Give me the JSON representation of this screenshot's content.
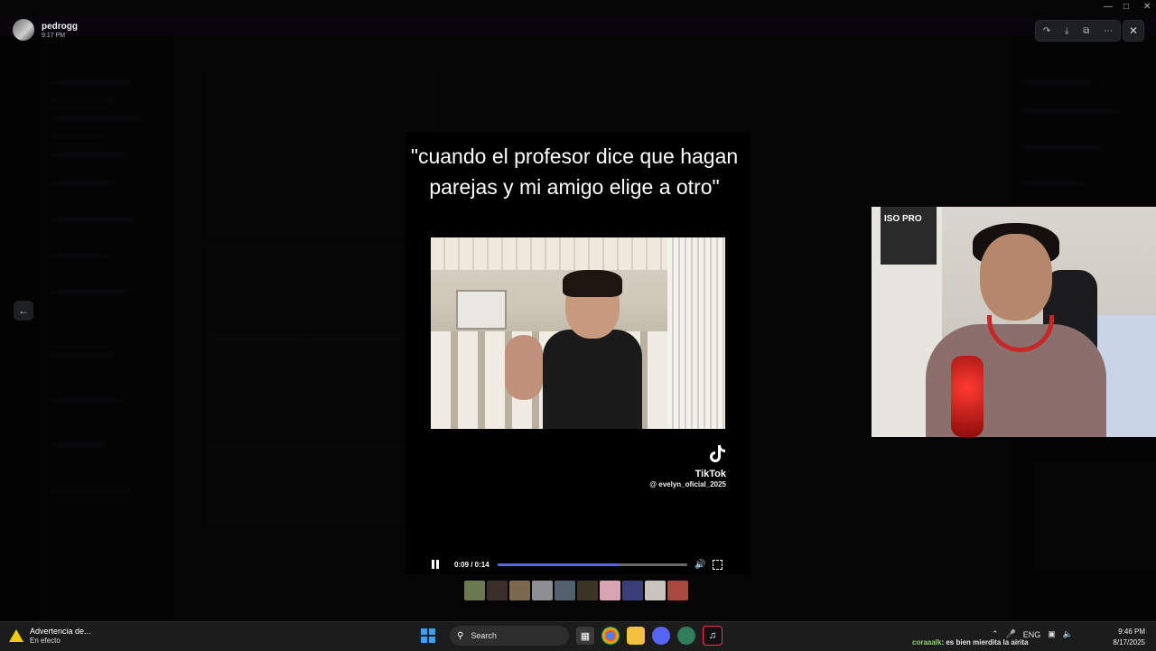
{
  "viewer": {
    "author_name": "pedrogg",
    "author_time": "9:17 PM",
    "toolbar_icons": [
      "forward-icon",
      "download-icon",
      "open-external-icon",
      "more-icon"
    ],
    "close_icon": "close-icon",
    "prev_icon": "arrow-left-icon"
  },
  "video": {
    "caption": "\"cuando el profesor dice que hagan parejas y mi amigo elige a otro\"",
    "watermark_brand": "TikTok",
    "watermark_handle": "@ evelyn_oficial_2025",
    "time_display": "0:09 / 0:14",
    "progress_fraction": 0.64,
    "playing": true
  },
  "thumbnails": {
    "count": 10,
    "colors": [
      "#6b7a4c",
      "#3a2f2a",
      "#7c6a4e",
      "#8d8f92",
      "#52606d",
      "#3c3424",
      "#d7a4b1",
      "#3a3f7a",
      "#c9c4bc",
      "#a8493f"
    ]
  },
  "webcam": {
    "box_label": "ISO PRO"
  },
  "taskbar": {
    "notification_title": "Advertencia de...",
    "notification_subtitle": "En efecto",
    "search_label": "Search",
    "chat_user": "coraaalk",
    "chat_message": ": es bien mierdita la airita",
    "language": "ENG",
    "time": "9:46 PM",
    "date": "8/17/2025"
  },
  "colors": {
    "accent": "#5865f2",
    "warning": "#f2c811"
  }
}
